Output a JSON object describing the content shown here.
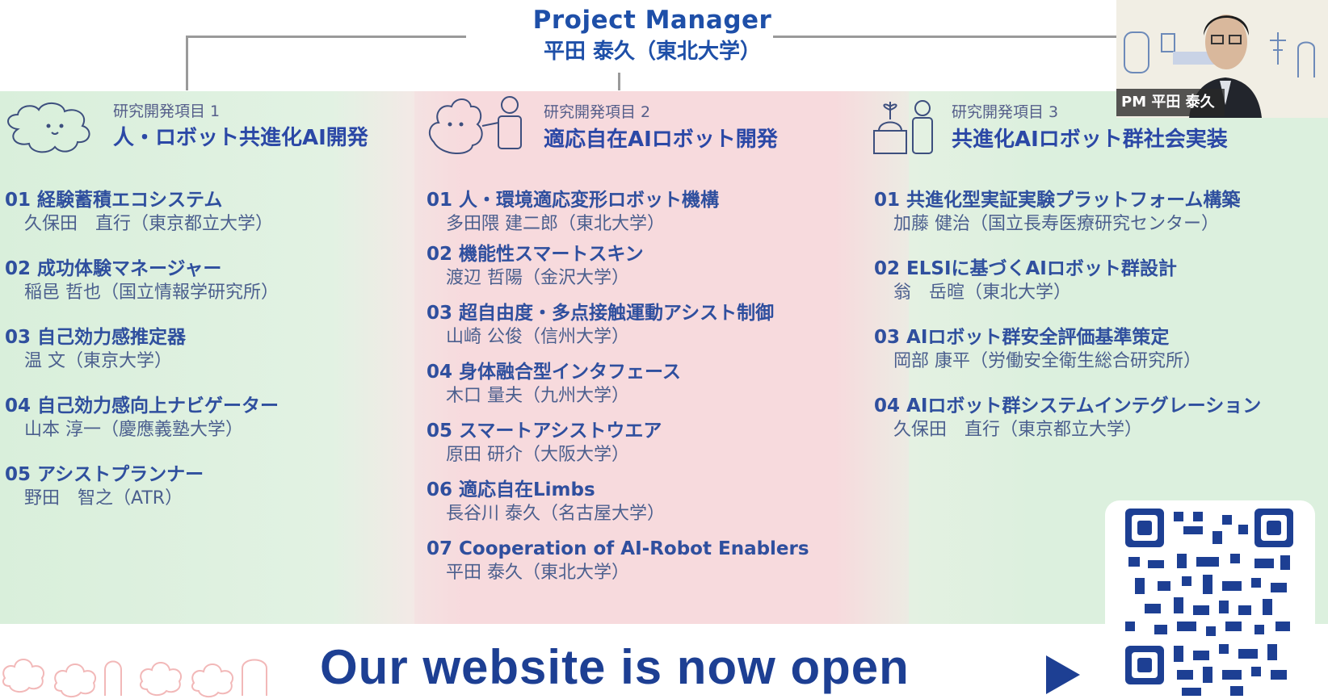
{
  "project_manager": {
    "title": "Project Manager",
    "name": "平田 泰久（東北大学）"
  },
  "columns": [
    {
      "small": "研究開発項目 1",
      "title": "人・ロボット共進化AI開発",
      "items": [
        {
          "heading": "01 経験蓄積エコシステム",
          "person": "久保田　直行（東京都立大学）"
        },
        {
          "heading": "02 成功体験マネージャー",
          "person": "稲邑 哲也（国立情報学研究所）"
        },
        {
          "heading": "03 自己効力感推定器",
          "person": "温 文（東京大学）"
        },
        {
          "heading": "04 自己効力感向上ナビゲーター",
          "person": "山本 淳一（慶應義塾大学）"
        },
        {
          "heading": "05 アシストプランナー",
          "person": "野田　智之（ATR）"
        }
      ]
    },
    {
      "small": "研究開発項目 2",
      "title": "適応自在AIロボット開発",
      "items": [
        {
          "heading": "01 人・環境適応変形ロボット機構",
          "person": "多田隈 建二郎（東北大学）"
        },
        {
          "heading": "02 機能性スマートスキン",
          "person": "渡辺 哲陽（金沢大学）"
        },
        {
          "heading": "03 超自由度・多点接触運動アシスト制御",
          "person": "山崎 公俊（信州大学）"
        },
        {
          "heading": "04 身体融合型インタフェース",
          "person": "木口 量夫（九州大学）"
        },
        {
          "heading": "05 スマートアシストウエア",
          "person": "原田 研介（大阪大学）"
        },
        {
          "heading": "06 適応自在Limbs",
          "person": "長谷川 泰久（名古屋大学）"
        },
        {
          "heading": "07 Cooperation of AI-Robot Enablers",
          "person": "平田 泰久（東北大学）"
        }
      ]
    },
    {
      "small": "研究開発項目 3",
      "title": "共進化AIロボット群社会実装",
      "items": [
        {
          "heading": "01 共進化型実証実験プラットフォーム構築",
          "person": "加藤 健治（国立長寿医療研究センター）"
        },
        {
          "heading": "02 ELSIに基づくAIロボット群設計",
          "person": "翁　岳暄（東北大学）"
        },
        {
          "heading": "03 AIロボット群安全評価基準策定",
          "person": "岡部 康平（労働安全衛生総合研究所）"
        },
        {
          "heading": "04 AIロボット群システムインテグレーション",
          "person": "久保田　直行（東京都立大学）"
        }
      ]
    }
  ],
  "banner": {
    "text": "Our website is now open"
  },
  "video": {
    "name_label": "PM 平田 泰久"
  },
  "qr": {
    "icon": "qr-code-icon"
  },
  "colors": {
    "navy": "#1d3f93",
    "green_bg": "#dcf0de",
    "pink_bg": "#f7dadd"
  }
}
